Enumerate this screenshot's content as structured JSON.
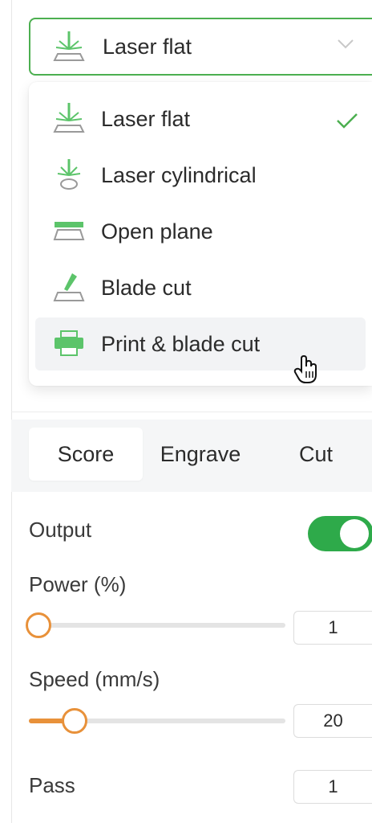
{
  "mode_select": {
    "selected_label": "Laser flat",
    "selected_icon": "laser-flat-icon"
  },
  "menu": {
    "items": [
      {
        "label": "Laser flat",
        "icon": "laser-flat-icon",
        "selected": true
      },
      {
        "label": "Laser cylindrical",
        "icon": "laser-cylindrical-icon",
        "selected": false
      },
      {
        "label": "Open plane",
        "icon": "open-plane-icon",
        "selected": false
      },
      {
        "label": "Blade cut",
        "icon": "blade-cut-icon",
        "selected": false
      },
      {
        "label": "Print & blade cut",
        "icon": "print-blade-cut-icon",
        "selected": false,
        "hovered": true
      }
    ]
  },
  "tabs": [
    {
      "label": "Score",
      "active": true
    },
    {
      "label": "Engrave",
      "active": false
    },
    {
      "label": "Cut",
      "active": false
    }
  ],
  "settings": {
    "output_label": "Output",
    "output_on": true,
    "power_label": "Power (%)",
    "power_value": "1",
    "power_fraction": 0.0,
    "speed_label": "Speed (mm/s)",
    "speed_value": "20",
    "speed_fraction": 0.14,
    "pass_label": "Pass",
    "pass_value": "1"
  },
  "colors": {
    "accent_green": "#4caf50",
    "toggle_green": "#2eaa4a",
    "slider_orange": "#e8913a"
  }
}
